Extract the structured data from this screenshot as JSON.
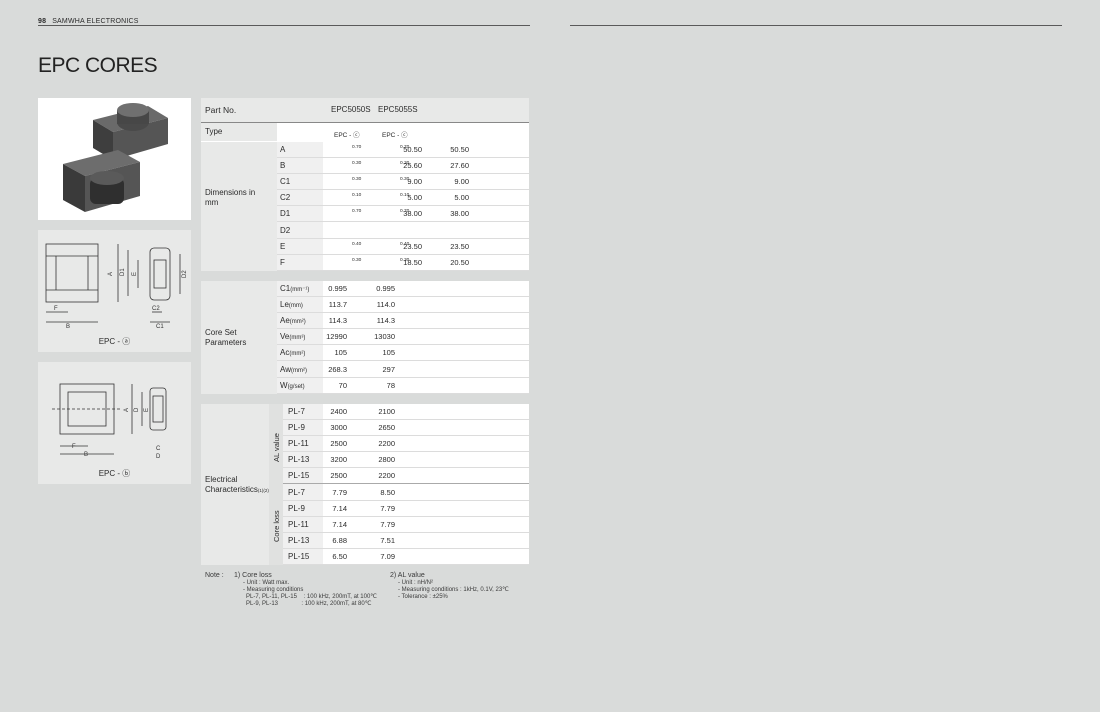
{
  "header": {
    "page_number": "98",
    "company": "SAMWHA ELECTRONICS"
  },
  "title": "EPC CORES",
  "figures": {
    "a": {
      "caption": "EPC - ⓐ",
      "labels": [
        "A",
        "D1",
        "E",
        "D2",
        "F",
        "B",
        "C2",
        "C1"
      ]
    },
    "b": {
      "caption": "EPC - ⓑ",
      "labels": [
        "A",
        "D",
        "E",
        "F",
        "B",
        "C",
        "D"
      ]
    }
  },
  "table": {
    "col_part": "Part No.",
    "parts": [
      "EPC5050S",
      "EPC5055S"
    ],
    "type_label": "Type",
    "types": [
      "EPC - ⓒ",
      "EPC - ⓒ"
    ],
    "dim_group": "Dimensions in mm",
    "dims": [
      {
        "name": "A",
        "v1": "50.50",
        "t1": "0.70",
        "v2": "50.50",
        "t2": "0.70"
      },
      {
        "name": "B",
        "v1": "25.60",
        "t1": "0.30",
        "v2": "27.60",
        "t2": "0.30"
      },
      {
        "name": "C1",
        "v1": "9.00",
        "t1": "0.30",
        "v2": "9.00",
        "t2": "0.30"
      },
      {
        "name": "C2",
        "v1": "5.00",
        "t1": "0.10",
        "v2": "5.00",
        "t2": "0.10"
      },
      {
        "name": "D1",
        "v1": "38.00",
        "t1": "0.70",
        "v2": "38.00",
        "t2": "0.70"
      },
      {
        "name": "D2",
        "v1": "",
        "t1": "",
        "v2": "",
        "t2": ""
      },
      {
        "name": "E",
        "v1": "23.50",
        "t1": "0.40",
        "v2": "23.50",
        "t2": "0.40"
      },
      {
        "name": "F",
        "v1": "18.50",
        "t1": "0.30",
        "v2": "20.50",
        "t2": "0.30"
      }
    ],
    "core_group": "Core Set Parameters",
    "core": [
      {
        "name": "C1",
        "unit": "(mm⁻¹)",
        "v1": "0.995",
        "v2": "0.995"
      },
      {
        "name": "Le",
        "unit": "(mm)",
        "v1": "113.7",
        "v2": "114.0"
      },
      {
        "name": "Ae",
        "unit": "(mm²)",
        "v1": "114.3",
        "v2": "114.3"
      },
      {
        "name": "Ve",
        "unit": "(mm³)",
        "v1": "12990",
        "v2": "13030"
      },
      {
        "name": "Ac",
        "unit": "(mm²)",
        "v1": "105",
        "v2": "105"
      },
      {
        "name": "Aw",
        "unit": "(mm²)",
        "v1": "268.3",
        "v2": "297"
      },
      {
        "name": "W",
        "unit": "(g/set)",
        "v1": "70",
        "v2": "78"
      }
    ],
    "elec_group": "Electrical Characteristics",
    "elec_note_ref": "(1)(2)",
    "al_label": "AL value",
    "al": [
      {
        "name": "PL-7",
        "v1": "2400",
        "v2": "2100"
      },
      {
        "name": "PL-9",
        "v1": "3000",
        "v2": "2650"
      },
      {
        "name": "PL-11",
        "v1": "2500",
        "v2": "2200"
      },
      {
        "name": "PL-13",
        "v1": "3200",
        "v2": "2800"
      },
      {
        "name": "PL-15",
        "v1": "2500",
        "v2": "2200"
      }
    ],
    "loss_label": "Core loss",
    "loss": [
      {
        "name": "PL-7",
        "v1": "7.79",
        "v2": "8.50"
      },
      {
        "name": "PL-9",
        "v1": "7.14",
        "v2": "7.79"
      },
      {
        "name": "PL-11",
        "v1": "7.14",
        "v2": "7.79"
      },
      {
        "name": "PL-13",
        "v1": "6.88",
        "v2": "7.51"
      },
      {
        "name": "PL-15",
        "v1": "6.50",
        "v2": "7.09"
      }
    ]
  },
  "notes": {
    "label": "Note :",
    "n1_title": "1) Core loss",
    "n1_lines": [
      "- Unit : Watt max.",
      "- Measuring conditions",
      "PL-7, PL-11, PL-15    : 100 kHz, 200mT, at 100℃",
      "PL-9, PL-13              : 100 kHz, 200mT, at 80℃"
    ],
    "n2_title": "2) AL value",
    "n2_lines": [
      "- Unit : nH/N²",
      "- Measuring conditions : 1kHz, 0.1V, 23℃",
      "- Tolerance : ±25%"
    ]
  }
}
